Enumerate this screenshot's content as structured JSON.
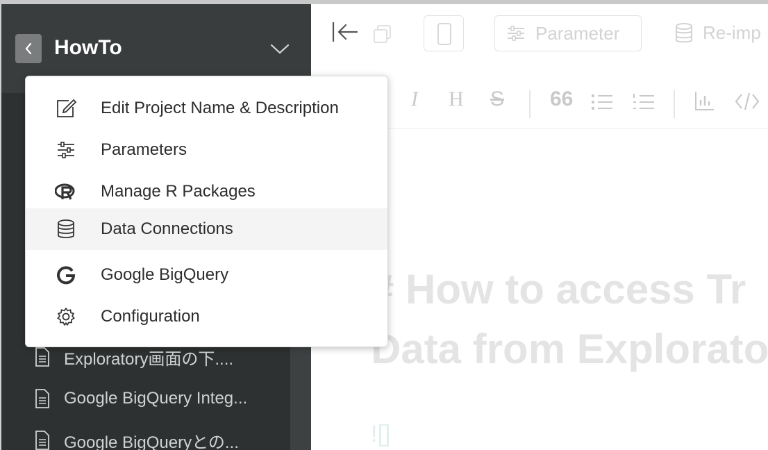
{
  "sidebar": {
    "project_title": "HowTo",
    "documents": [
      {
        "label": "Exploratory画面の下...."
      },
      {
        "label": "Google BigQuery Integ..."
      },
      {
        "label": "Google BigQueryとの..."
      }
    ]
  },
  "project_menu": {
    "items": [
      {
        "label": "Edit Project Name & Description",
        "icon": "edit-icon"
      },
      {
        "label": "Parameters",
        "icon": "sliders-icon"
      },
      {
        "label": "Manage R Packages",
        "icon": "r-logo-icon"
      },
      {
        "label": "Data Connections",
        "icon": "database-icon",
        "highlighted": true
      },
      {
        "label": "Google BigQuery",
        "icon": "google-icon"
      },
      {
        "label": "Configuration",
        "icon": "gear-icon"
      }
    ]
  },
  "toolbar": {
    "parameter_label": "Parameter",
    "reimport_label": "Re-imp"
  },
  "format_bar": {
    "italic": "I",
    "heading": "H",
    "strike": "S",
    "quote": "66"
  },
  "editor": {
    "heading_line1": "# How to access Tr",
    "heading_line2": "Data from Explorato",
    "image_markdown": "![]"
  },
  "colors": {
    "sidebar_bg": "#2e3131",
    "sidebar_header_bg": "#3a3d3e",
    "menu_hover": "#f4f4f4"
  }
}
